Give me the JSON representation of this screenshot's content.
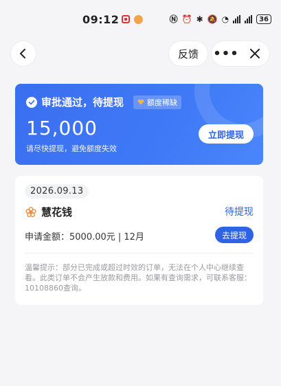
{
  "status_bar": {
    "time": "09:12",
    "battery": "36"
  },
  "nav": {
    "feedback_label": "反馈",
    "more_label": "•••"
  },
  "hero": {
    "status_text": "审批通过，待提现",
    "badge_text": "额度稀缺",
    "amount": "15,000",
    "subtitle": "请尽快提现，避免额度失效",
    "button_label": "立即提现"
  },
  "order": {
    "date": "2026.09.13",
    "product_name": "慧花钱",
    "status": "待提现",
    "apply_info": "申请金额：5000.00元 | 12月",
    "button_label": "去提现",
    "tip": "温馨提示：部分已完成或超过时效的订单，无法在个人中心继续查看。此类订单不会产生放款和费用。如果有查询需求，可联系客服：10108860查询。"
  },
  "colors": {
    "accent": "#2f63e6",
    "hero_bg": "#3f79f6",
    "badge_diamond": "#f6b24a",
    "page_bg": "#f5f5f7"
  },
  "icons": [
    "back-icon",
    "close-icon",
    "check-icon",
    "diamond-icon",
    "flower-icon"
  ]
}
